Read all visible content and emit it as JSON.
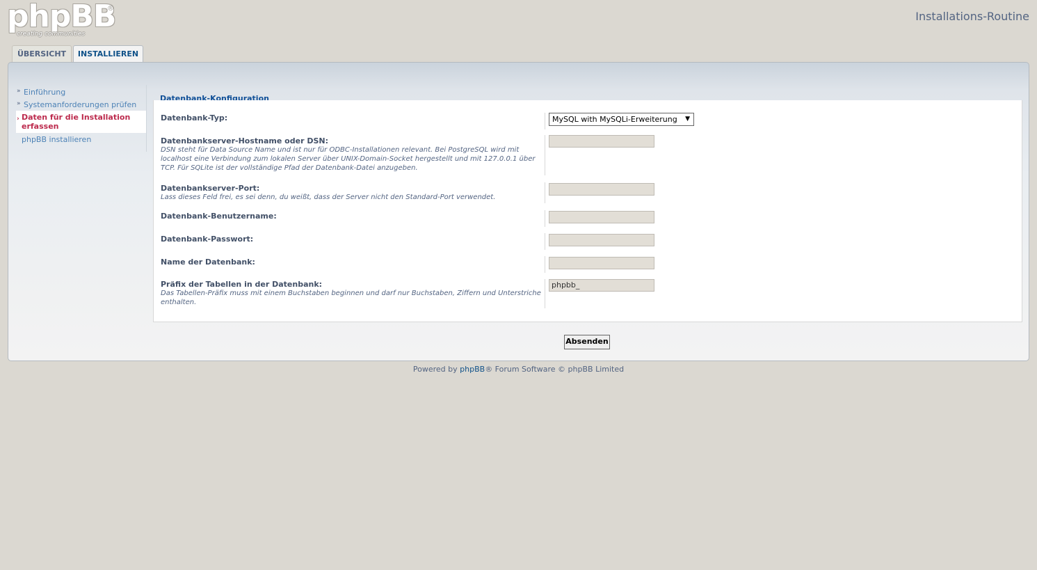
{
  "header": {
    "logo_text": "phpBB",
    "logo_registered": "®",
    "logo_tagline": "creating communities",
    "page_title": "Installations-Routine"
  },
  "tabs": [
    {
      "label": "ÜBERSICHT",
      "active": false
    },
    {
      "label": "INSTALLIEREN",
      "active": true
    }
  ],
  "menu": [
    {
      "label": "Einführung",
      "state": "done"
    },
    {
      "label": "Systemanforderungen prüfen",
      "state": "done"
    },
    {
      "label": "Daten für die Installation erfassen",
      "state": "active"
    },
    {
      "label": "phpBB installieren",
      "state": "pending"
    }
  ],
  "form": {
    "legend": "Datenbank-Konfiguration",
    "db_type": {
      "label": "Datenbank-Typ:",
      "selected": "MySQL with MySQLi-Erweiterung"
    },
    "host": {
      "label": "Datenbankserver-Hostname oder DSN:",
      "explain": "DSN steht für Data Source Name und ist nur für ODBC-Installationen relevant. Bei PostgreSQL wird mit localhost eine Verbindung zum lokalen Server über UNIX-Domain-Socket hergestellt und mit 127.0.0.1 über TCP. Für SQLite ist der vollständige Pfad der Datenbank-Datei anzugeben.",
      "value": ""
    },
    "port": {
      "label": "Datenbankserver-Port:",
      "explain": "Lass dieses Feld frei, es sei denn, du weißt, dass der Server nicht den Standard-Port verwendet.",
      "value": ""
    },
    "user": {
      "label": "Datenbank-Benutzername:",
      "value": ""
    },
    "password": {
      "label": "Datenbank-Passwort:",
      "value": ""
    },
    "dbname": {
      "label": "Name der Datenbank:",
      "value": ""
    },
    "prefix": {
      "label": "Präfix der Tabellen in der Datenbank:",
      "explain": "Das Tabellen-Präfix muss mit einem Buchstaben beginnen und darf nur Buchstaben, Ziffern und Unterstriche enthalten.",
      "value": "phpbb_"
    },
    "submit_label": "Absenden"
  },
  "footer": {
    "prefix": "Powered by",
    "link": "phpBB",
    "suffix": "® Forum Software © phpBB Limited"
  }
}
